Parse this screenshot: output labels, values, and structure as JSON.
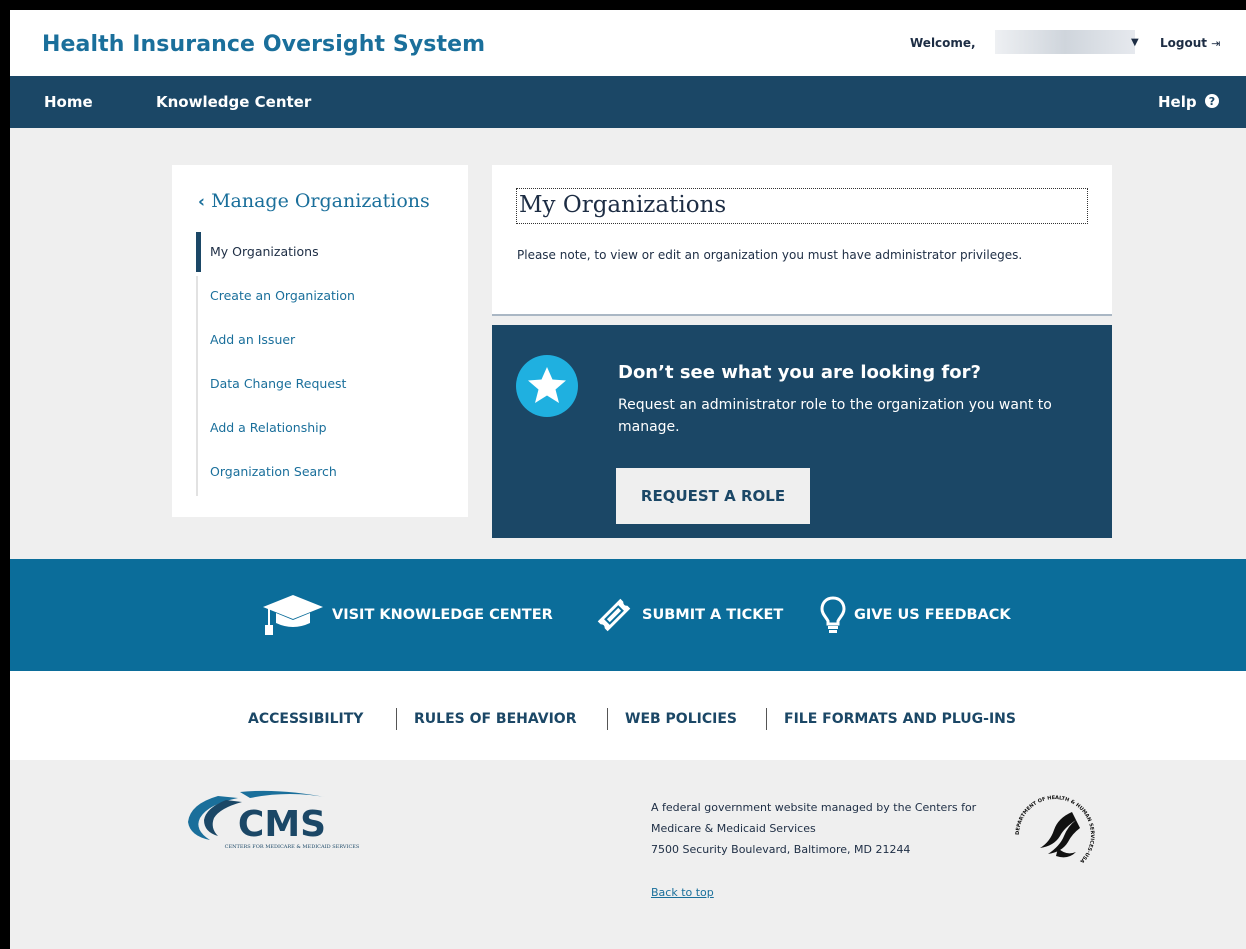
{
  "header": {
    "site_title": "Health Insurance Oversight System",
    "welcome_label": "Welcome,",
    "logout_label": "Logout"
  },
  "nav": {
    "home": "Home",
    "knowledge_center": "Knowledge Center",
    "help": "Help"
  },
  "sidebar": {
    "title": "Manage Organizations",
    "items": [
      {
        "label": "My Organizations",
        "active": true
      },
      {
        "label": "Create an Organization"
      },
      {
        "label": "Add an Issuer"
      },
      {
        "label": "Data Change Request"
      },
      {
        "label": "Add a Relationship"
      },
      {
        "label": "Organization Search"
      }
    ]
  },
  "main": {
    "title": "My Organizations",
    "note": "Please note, to view or edit an organization you must have administrator privileges."
  },
  "role_panel": {
    "title": "Don’t see what you are looking for?",
    "text": "Request an administrator role to the organization you want to manage.",
    "button": "REQUEST A ROLE"
  },
  "help_band": {
    "knowledge_center": "VISIT KNOWLEDGE CENTER",
    "ticket": "SUBMIT A TICKET",
    "feedback": "GIVE US FEEDBACK"
  },
  "footer_links": [
    "ACCESSIBILITY",
    "RULES OF BEHAVIOR",
    "WEB POLICIES",
    "FILE FORMATS AND PLUG-INS"
  ],
  "footer": {
    "line1": "A federal government website managed by the Centers for",
    "line2": "Medicare & Medicaid Services",
    "line3": "7500 Security Boulevard, Baltimore, MD 21244",
    "back_to_top": "Back to top",
    "cms_logo_text": "CMS",
    "cms_logo_subtitle": "CENTERS FOR MEDICARE & MEDICAID SERVICES",
    "hhs_seal_text": "DEPARTMENT OF HEALTH & HUMAN SERVICES·USA"
  },
  "colors": {
    "brand_blue": "#1a6f9b",
    "navy": "#1b4766",
    "help_band": "#0b6d9a",
    "star_circle": "#1fb0e0"
  }
}
